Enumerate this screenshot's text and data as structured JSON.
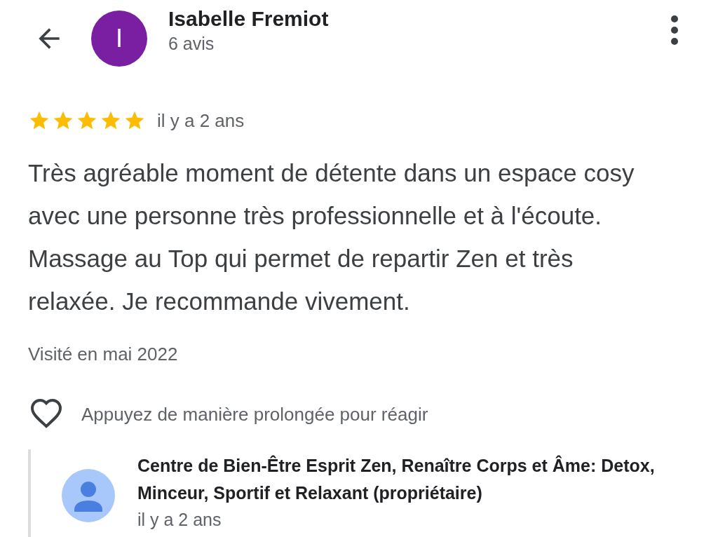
{
  "reviewer": {
    "initial": "I",
    "name": "Isabelle Fremiot",
    "review_count": "6 avis"
  },
  "review": {
    "stars": 5,
    "time": "il y a 2 ans",
    "text": "Très agréable moment de détente dans un espace cosy avec une personne très professionnelle et à l'écoute. Massage au Top qui permet de repartir Zen et très relaxée. Je recommande vivement.",
    "visited": "Visité en mai 2022"
  },
  "reaction": {
    "liked": false,
    "hint": "Appuyez de manière prolongée pour réagir"
  },
  "owner_reply": {
    "name": "Centre de Bien-Être Esprit Zen, Renaître Corps et Âme: Detox, Minceur, Sportif et Relaxant (propriétaire)",
    "time": "il y a 2 ans"
  }
}
